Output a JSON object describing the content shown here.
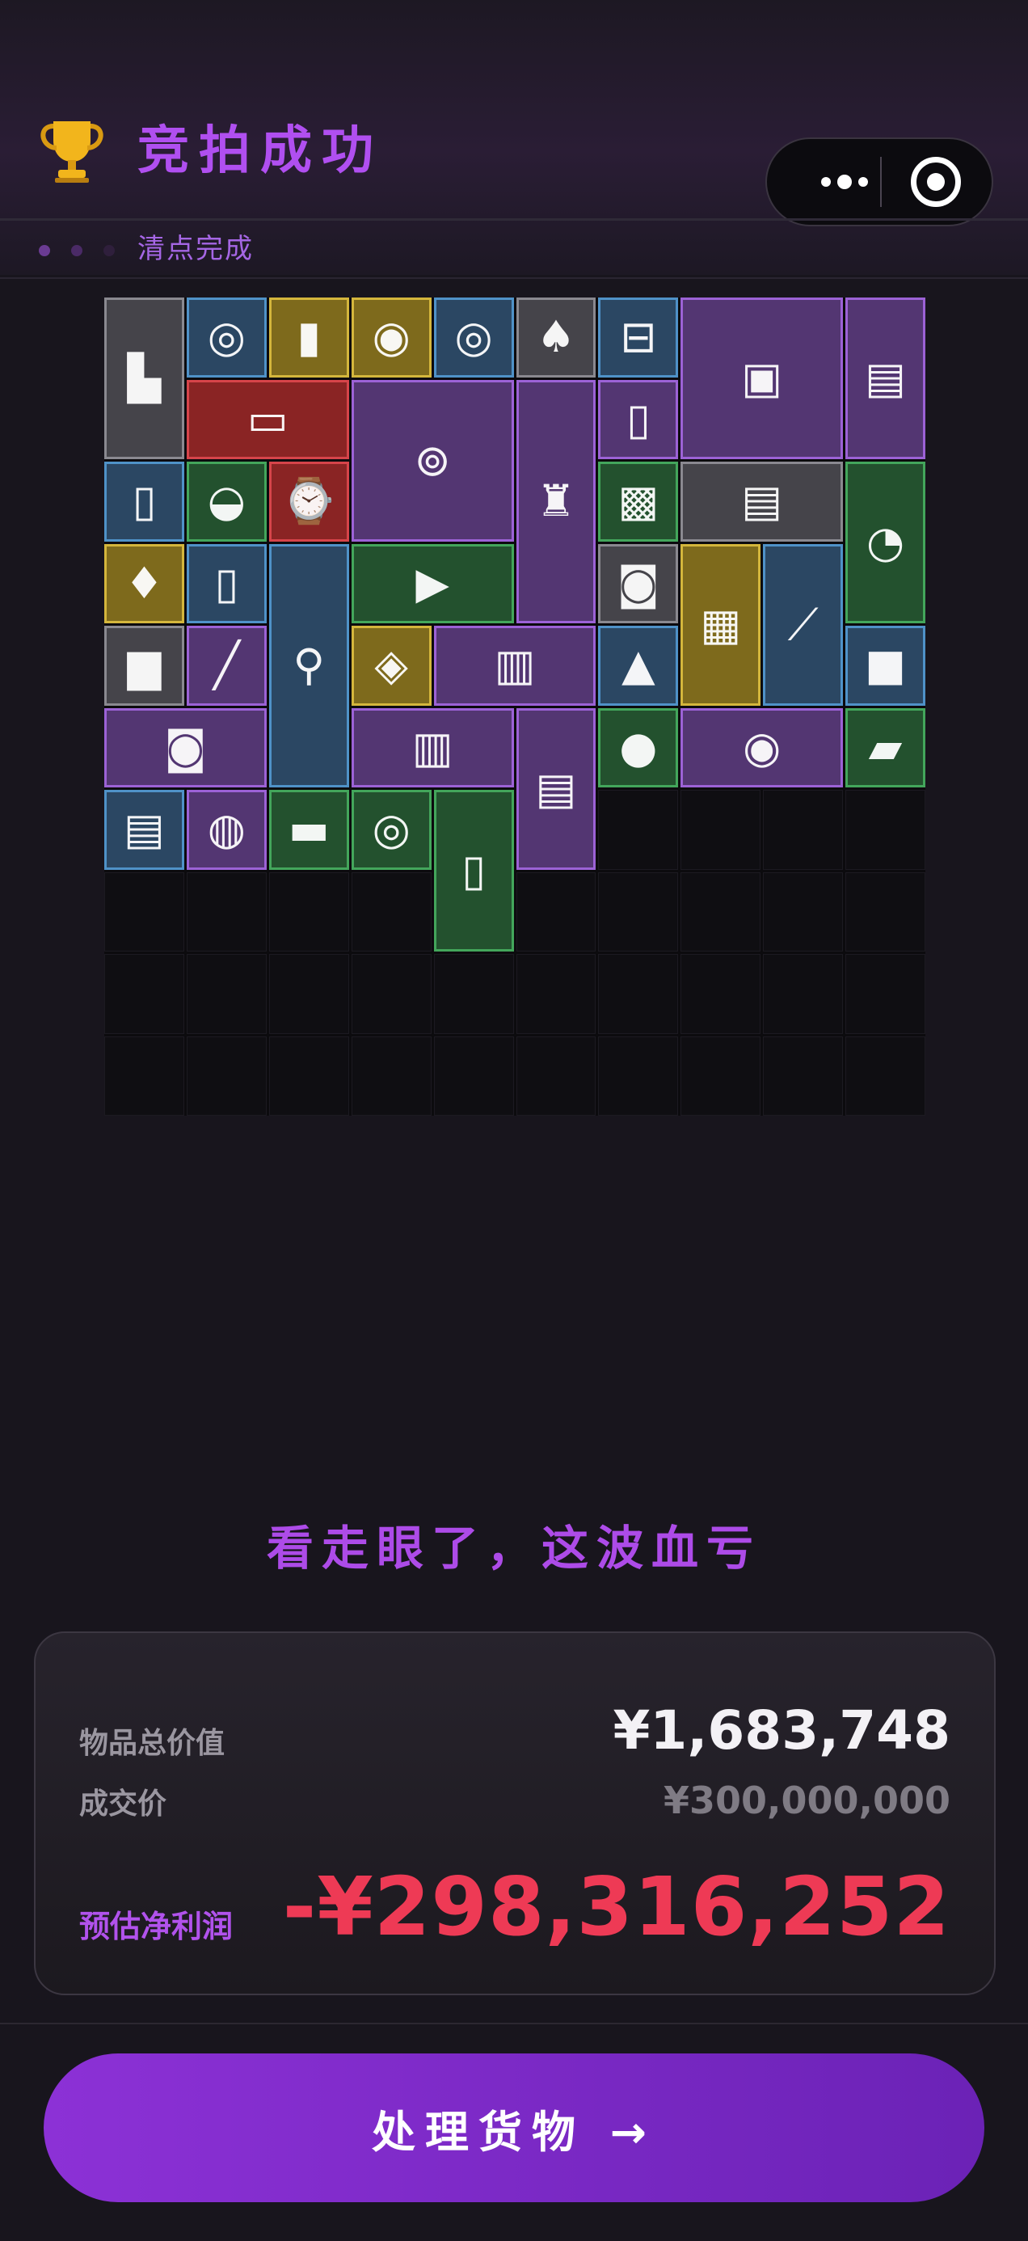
{
  "header": {
    "trophy_icon": "trophy-icon",
    "title": "竞拍成功",
    "menu_icon": "more-dots-icon",
    "close_icon": "target-circle-icon"
  },
  "status": {
    "dots": [
      "#6a3b92",
      "#4a2a66",
      "#2f1f3c"
    ],
    "text": "清点完成"
  },
  "grid": {
    "columns": 10,
    "rows": 10,
    "rarity_colors": {
      "gray": "#8a8990",
      "blue": "#4f92c8",
      "gold": "#d4b63c",
      "purple": "#9c62d6",
      "red": "#d6444a",
      "green": "#43a65b"
    },
    "items": [
      {
        "name": "black-bracket",
        "icon": "bracket-icon",
        "rarity": "gray"
      },
      {
        "name": "cd-disc-1",
        "icon": "disc-icon",
        "rarity": "blue"
      },
      {
        "name": "asthma-inhaler",
        "icon": "inhaler-icon",
        "rarity": "gold"
      },
      {
        "name": "camera-lens-small",
        "icon": "lens-icon",
        "rarity": "gold"
      },
      {
        "name": "cd-disc-2",
        "icon": "disc-icon",
        "rarity": "blue"
      },
      {
        "name": "playing-card",
        "icon": "card-icon",
        "rarity": "gray"
      },
      {
        "name": "jar-container",
        "icon": "jar-icon",
        "rarity": "blue"
      },
      {
        "name": "blood-pressure-monitor",
        "icon": "bp-monitor-icon",
        "rarity": "purple"
      },
      {
        "name": "old-book",
        "icon": "book-icon",
        "rarity": "purple"
      },
      {
        "name": "rugged-tablet",
        "icon": "tablet-icon",
        "rarity": "red"
      },
      {
        "name": "centrifuge",
        "icon": "centrifuge-icon",
        "rarity": "purple"
      },
      {
        "name": "lantern",
        "icon": "lantern-icon",
        "rarity": "purple"
      },
      {
        "name": "energy-drink-can",
        "icon": "can-icon",
        "rarity": "purple"
      },
      {
        "name": "cola-can",
        "icon": "cola-icon",
        "rarity": "blue"
      },
      {
        "name": "ashtray",
        "icon": "ashtray-icon",
        "rarity": "green"
      },
      {
        "name": "gold-watch",
        "icon": "watch-icon",
        "rarity": "red"
      },
      {
        "name": "circuit-chip",
        "icon": "chip-icon",
        "rarity": "green"
      },
      {
        "name": "newspaper",
        "icon": "newspaper-icon",
        "rarity": "gray"
      },
      {
        "name": "pressure-gauge",
        "icon": "gauge-icon",
        "rarity": "green"
      },
      {
        "name": "crystal-trophy",
        "icon": "award-icon",
        "rarity": "gold"
      },
      {
        "name": "pill-bottle",
        "icon": "bottle-icon",
        "rarity": "blue"
      },
      {
        "name": "microscope",
        "icon": "microscope-icon",
        "rarity": "blue"
      },
      {
        "name": "power-drill",
        "icon": "drill-icon",
        "rarity": "green"
      },
      {
        "name": "tape-measure",
        "icon": "tape-icon",
        "rarity": "gray"
      },
      {
        "name": "old-map",
        "icon": "map-icon",
        "rarity": "gold"
      },
      {
        "name": "telescope",
        "icon": "telescope-icon",
        "rarity": "blue"
      },
      {
        "name": "protein-tub",
        "icon": "tub-icon",
        "rarity": "gray"
      },
      {
        "name": "flare-stick",
        "icon": "flare-icon",
        "rarity": "purple"
      },
      {
        "name": "gold-ring",
        "icon": "ring-icon",
        "rarity": "gold"
      },
      {
        "name": "radio",
        "icon": "radio-icon",
        "rarity": "purple"
      },
      {
        "name": "warning-sign",
        "icon": "triangle-icon",
        "rarity": "blue"
      },
      {
        "name": "metal-cube",
        "icon": "cube-icon",
        "rarity": "blue"
      },
      {
        "name": "boombox",
        "icon": "boombox-icon",
        "rarity": "purple"
      },
      {
        "name": "graphics-card",
        "icon": "gpu-icon",
        "rarity": "purple"
      },
      {
        "name": "old-book-2",
        "icon": "book-icon",
        "rarity": "purple"
      },
      {
        "name": "ancient-coin",
        "icon": "coin-icon",
        "rarity": "green"
      },
      {
        "name": "zoom-lens",
        "icon": "lens-icon",
        "rarity": "purple"
      },
      {
        "name": "hard-drive",
        "icon": "drive-icon",
        "rarity": "green"
      },
      {
        "name": "ram-stick",
        "icon": "ram-icon",
        "rarity": "blue"
      },
      {
        "name": "herb-dish",
        "icon": "herb-icon",
        "rarity": "purple"
      },
      {
        "name": "battery-pack",
        "icon": "battery-icon",
        "rarity": "green"
      },
      {
        "name": "green-cable",
        "icon": "cable-icon",
        "rarity": "green"
      },
      {
        "name": "fire-cabinet",
        "icon": "cabinet-icon",
        "rarity": "green"
      }
    ]
  },
  "verdict": "看走眼了，这波血亏",
  "summary": {
    "total_label": "物品总价值",
    "total_value": "¥1,683,748",
    "deal_label": "成交价",
    "deal_value": "¥300,000,000",
    "profit_label": "预估净利润",
    "profit_value": "-¥298,316,252"
  },
  "cta": {
    "label": "处理货物 →"
  }
}
